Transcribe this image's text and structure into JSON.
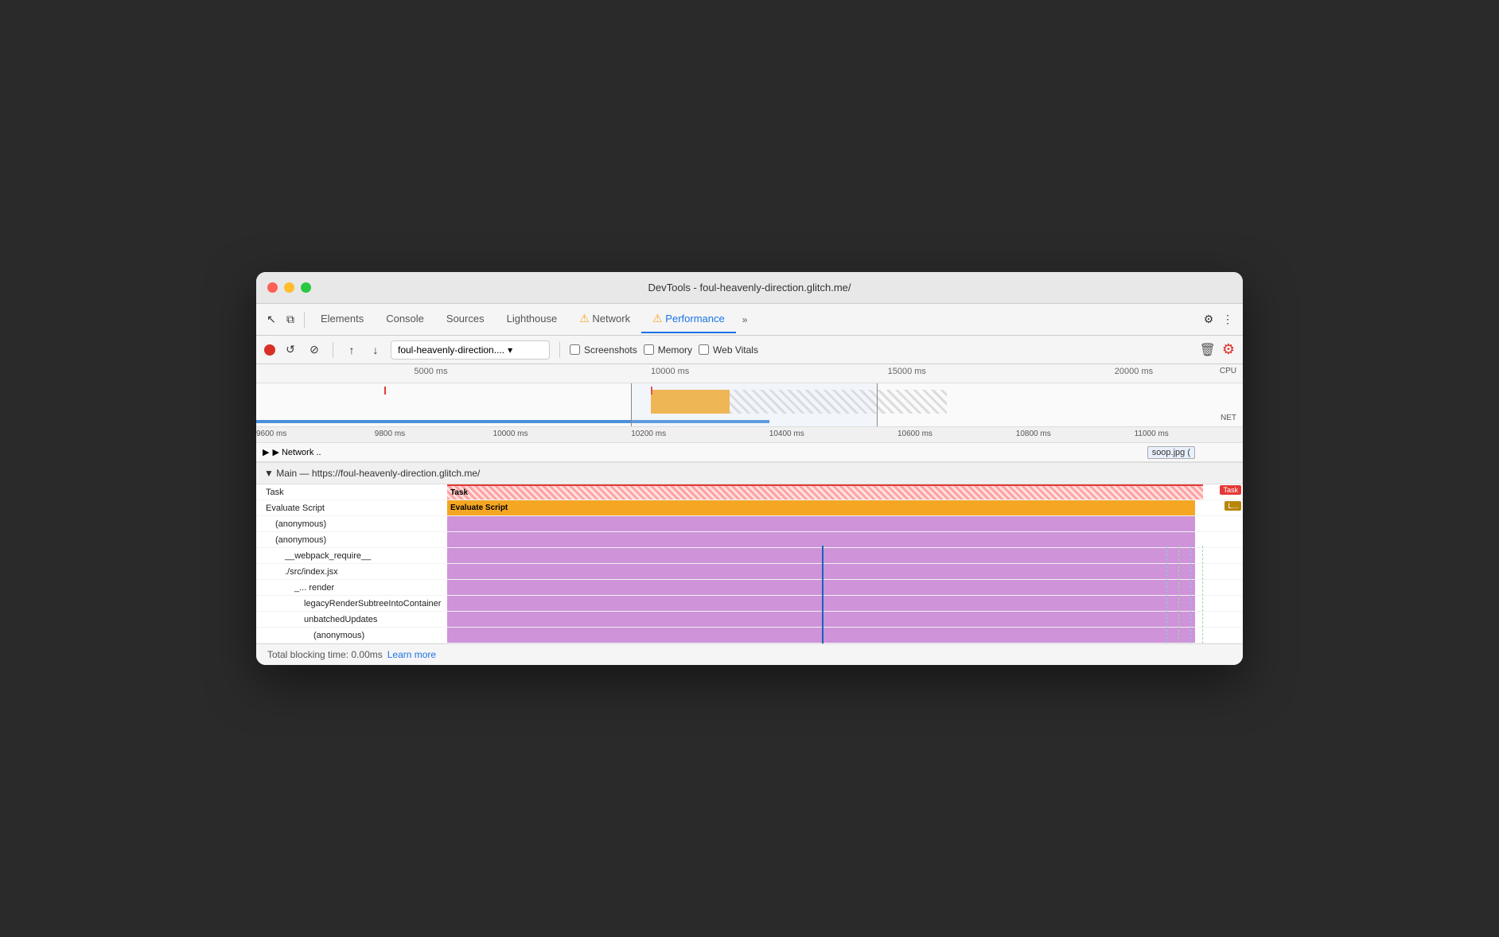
{
  "window": {
    "title": "DevTools - foul-heavenly-direction.glitch.me/"
  },
  "tabs": [
    {
      "id": "elements",
      "label": "Elements",
      "active": false
    },
    {
      "id": "console",
      "label": "Console",
      "active": false
    },
    {
      "id": "sources",
      "label": "Sources",
      "active": false
    },
    {
      "id": "lighthouse",
      "label": "Lighthouse",
      "active": false
    },
    {
      "id": "network",
      "label": "Network",
      "active": false,
      "warning": true
    },
    {
      "id": "performance",
      "label": "Performance",
      "active": true,
      "warning": true
    }
  ],
  "controls": {
    "url": "foul-heavenly-direction....",
    "screenshots_label": "Screenshots",
    "memory_label": "Memory",
    "web_vitals_label": "Web Vitals"
  },
  "ruler": {
    "marks": [
      "5000 ms",
      "10000 ms",
      "15000 ms",
      "20000 ms"
    ]
  },
  "time_ruler": {
    "marks": [
      "9600 ms",
      "9800 ms",
      "10000 ms",
      "10200 ms",
      "10400 ms",
      "10600 ms",
      "10800 ms",
      "11000 ms"
    ]
  },
  "network_row": {
    "label": "▶ Network ..",
    "badge": "soop.jpg ("
  },
  "flame": {
    "header": "▼ Main — https://foul-heavenly-direction.glitch.me/",
    "rows": [
      {
        "id": "task",
        "label": "Task",
        "indent": 0,
        "type": "task"
      },
      {
        "id": "evaluate-script",
        "label": "Evaluate Script",
        "indent": 0,
        "type": "script"
      },
      {
        "id": "anon1",
        "label": "(anonymous)",
        "indent": 1,
        "type": "purple"
      },
      {
        "id": "anon2",
        "label": "(anonymous)",
        "indent": 1,
        "type": "purple"
      },
      {
        "id": "webpack",
        "label": "__webpack_require__",
        "indent": 2,
        "type": "purple"
      },
      {
        "id": "src-index",
        "label": "./src/index.jsx",
        "indent": 2,
        "type": "purple"
      },
      {
        "id": "render",
        "label": "_...  render",
        "indent": 3,
        "type": "purple"
      },
      {
        "id": "legacy-render",
        "label": "legacyRenderSubtreeIntoContainer",
        "indent": 4,
        "type": "purple"
      },
      {
        "id": "unbatched",
        "label": "unbatchedUpdates",
        "indent": 4,
        "type": "purple"
      },
      {
        "id": "anon3",
        "label": "(anonymous)",
        "indent": 5,
        "type": "purple"
      }
    ]
  },
  "status": {
    "blocking_time": "Total blocking time: 0.00ms",
    "learn_more": "Learn more"
  },
  "icons": {
    "cursor": "↖",
    "layers": "⧉",
    "record": "●",
    "refresh": "↺",
    "ban": "⊘",
    "upload": "↑",
    "download": "↓",
    "more_tabs": "»",
    "settings": "⚙",
    "more_menu": "⋮",
    "trash": "🗑",
    "chevron": "▾",
    "triangle_right": "▶",
    "triangle_down": "▼",
    "warning": "⚠"
  }
}
